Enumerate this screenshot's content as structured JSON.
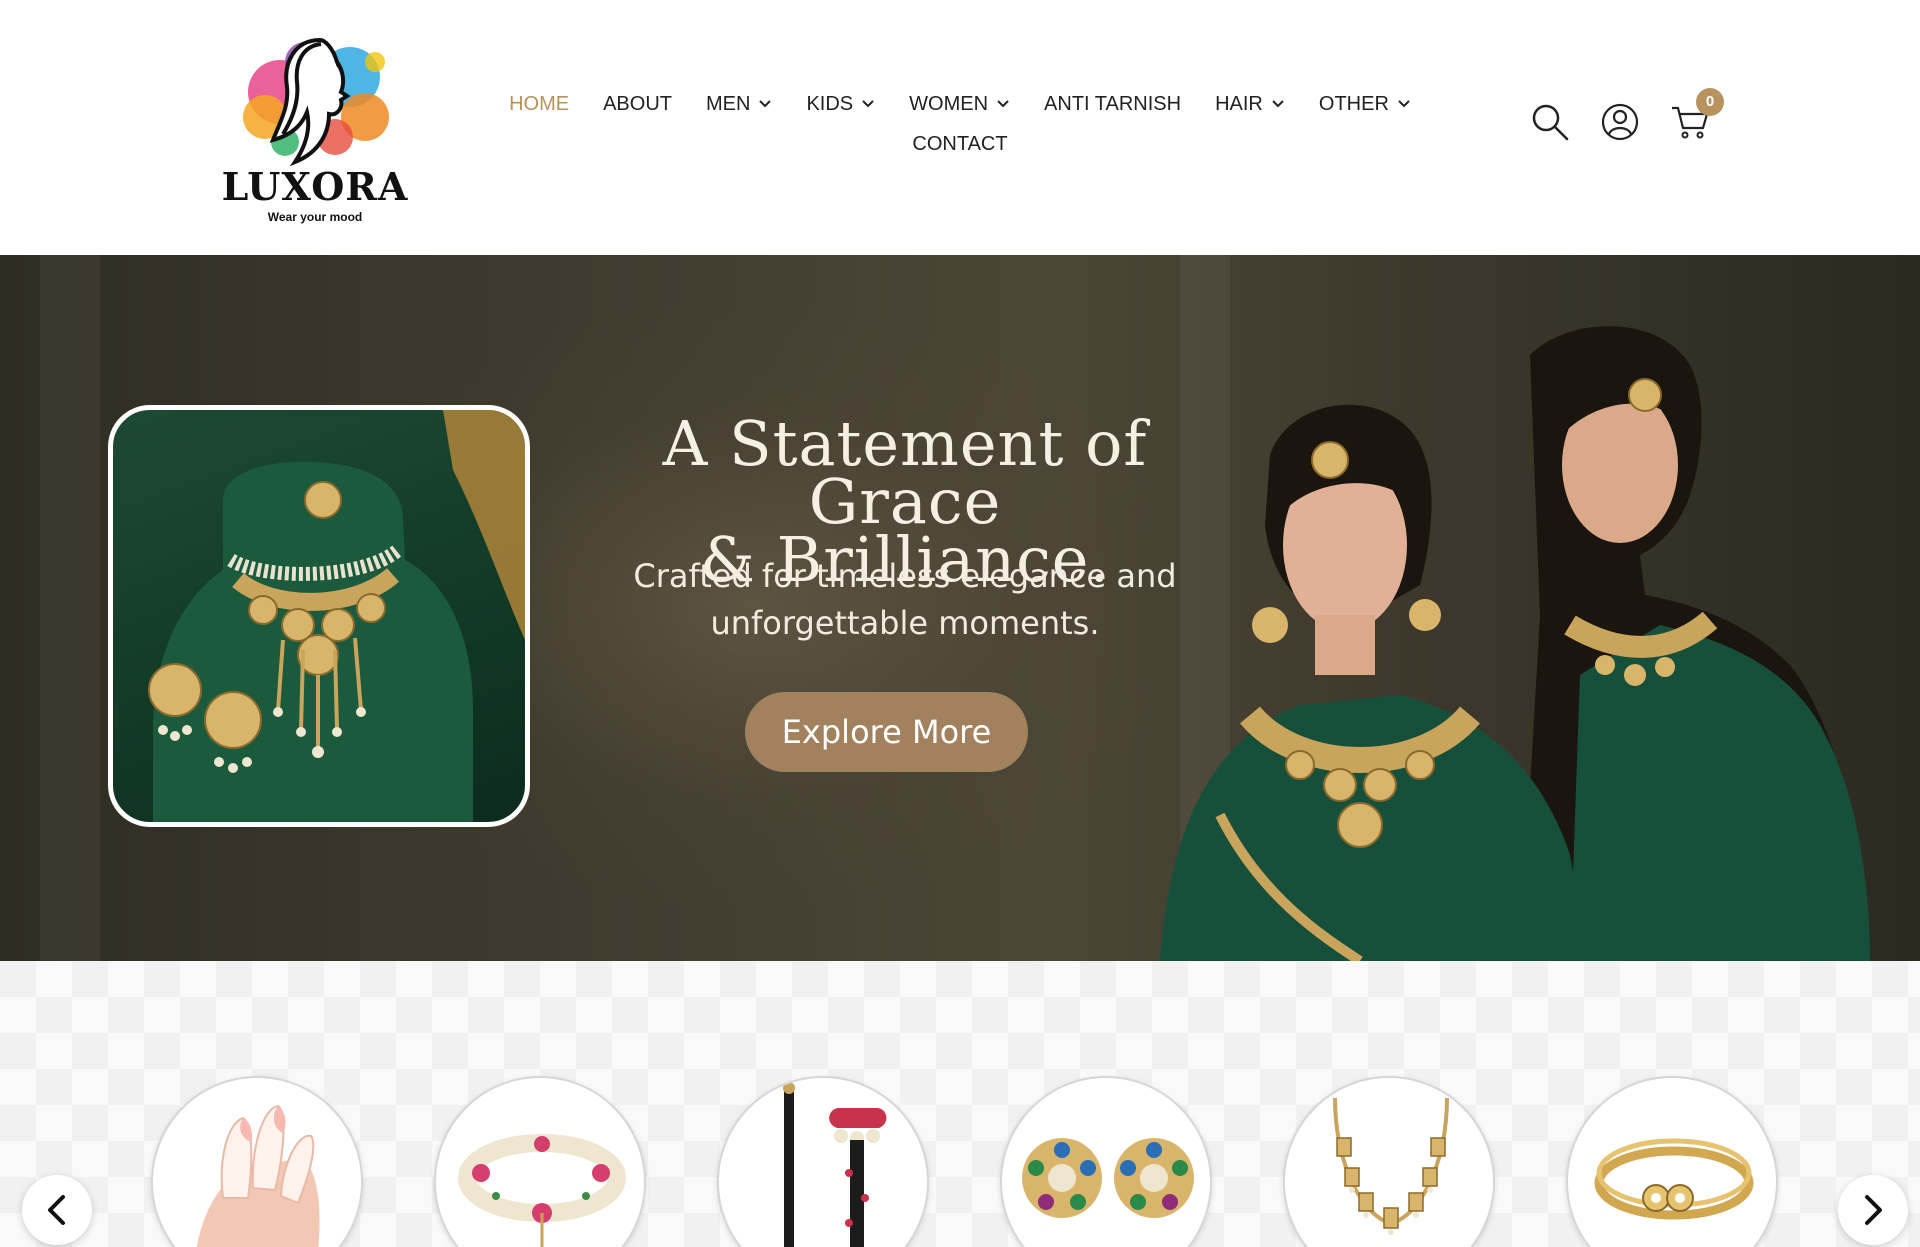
{
  "brand": {
    "name": "LUXORA",
    "tagline": "Wear your mood"
  },
  "nav": {
    "items": [
      {
        "label": "HOME",
        "active": true,
        "dropdown": false
      },
      {
        "label": "ABOUT",
        "active": false,
        "dropdown": false
      },
      {
        "label": "MEN",
        "active": false,
        "dropdown": true
      },
      {
        "label": "KIDS",
        "active": false,
        "dropdown": true
      },
      {
        "label": "WOMEN",
        "active": false,
        "dropdown": true
      },
      {
        "label": "ANTI TARNISH",
        "active": false,
        "dropdown": false
      },
      {
        "label": "HAIR",
        "active": false,
        "dropdown": true
      },
      {
        "label": "OTHER",
        "active": false,
        "dropdown": true
      },
      {
        "label": "CONTACT",
        "active": false,
        "dropdown": false
      }
    ]
  },
  "header_icons": {
    "search": "search-icon",
    "account": "user-icon",
    "cart": "cart-icon",
    "cart_count": "0"
  },
  "hero": {
    "title_line1": "A Statement of Grace",
    "title_line2": "& Brilliance.",
    "subtitle_line1": "Crafted for timeless elegance and",
    "subtitle_line2": "unforgettable moments.",
    "cta_label": "Explore More"
  },
  "categories": {
    "items": [
      {
        "icon": "nails-icon"
      },
      {
        "icon": "floral-bracelet-icon"
      },
      {
        "icon": "hair-accessory-icon"
      },
      {
        "icon": "stud-earrings-icon"
      },
      {
        "icon": "necklace-icon"
      },
      {
        "icon": "bangle-icon"
      }
    ],
    "prev_icon": "chevron-left-icon",
    "next_icon": "chevron-right-icon"
  },
  "colors": {
    "accent": "#b8935d",
    "button": "#a2825e",
    "hero_bg": "#403b2e",
    "emerald": "#17503a"
  }
}
